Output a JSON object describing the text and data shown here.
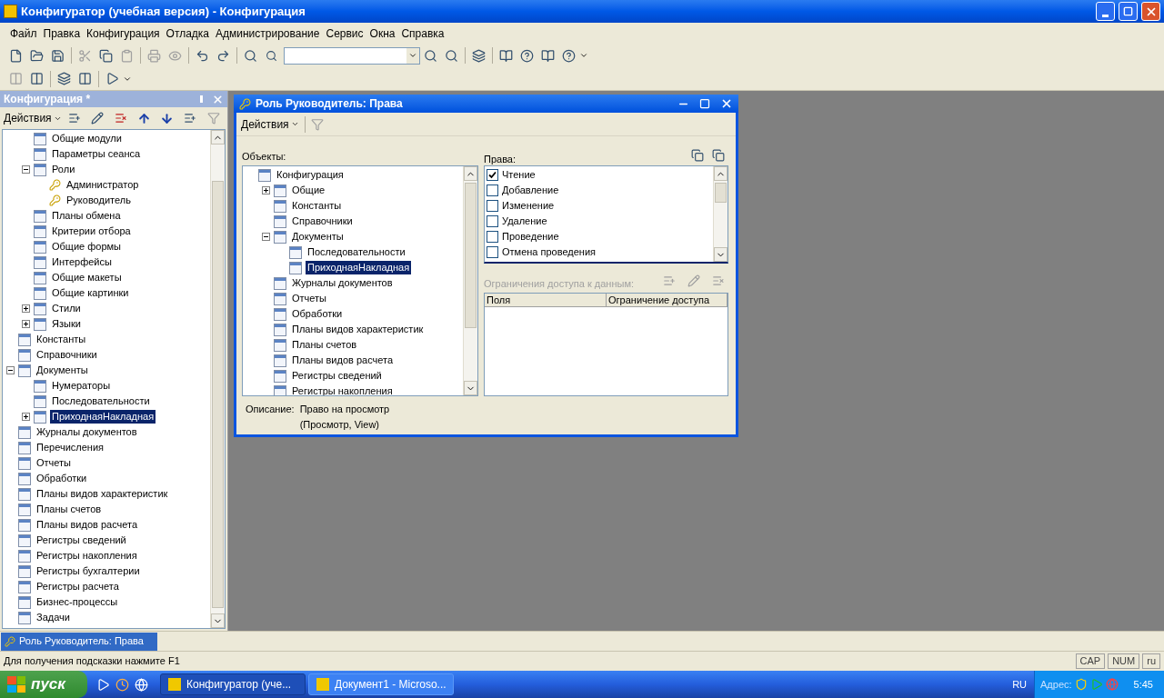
{
  "window": {
    "title": "Конфигуратор (учебная версия) - Конфигурация"
  },
  "menu": [
    "Файл",
    "Правка",
    "Конфигурация",
    "Отладка",
    "Администрирование",
    "Сервис",
    "Окна",
    "Справка"
  ],
  "config_panel": {
    "title": "Конфигурация *",
    "actions": "Действия",
    "tree": {
      "partial_group": [
        {
          "label": "Общие модули",
          "selected": false
        },
        {
          "label": "Параметры сеанса",
          "selected": false
        },
        {
          "label": "Роли",
          "selected": false,
          "expanded": true,
          "children": [
            {
              "label": "Администратор",
              "kind": "role",
              "selected": false
            },
            {
              "label": "Руководитель",
              "kind": "role",
              "selected": false
            }
          ]
        },
        {
          "label": "Планы обмена",
          "selected": false
        },
        {
          "label": "Критерии отбора",
          "selected": false
        },
        {
          "label": "Общие формы",
          "selected": false
        },
        {
          "label": "Интерфейсы",
          "selected": false
        },
        {
          "label": "Общие макеты",
          "selected": false
        },
        {
          "label": "Общие картинки",
          "selected": false
        },
        {
          "label": "Стили",
          "selected": false,
          "expanded": false
        },
        {
          "label": "Языки",
          "selected": false,
          "expanded": false
        }
      ],
      "items": [
        {
          "label": "Константы",
          "selected": false
        },
        {
          "label": "Справочники",
          "selected": false
        },
        {
          "label": "Документы",
          "selected": false,
          "expanded": true,
          "children": [
            {
              "label": "Нумераторы",
              "selected": false
            },
            {
              "label": "Последовательности",
              "selected": false
            },
            {
              "label": "ПриходнаяНакладная",
              "selected": true,
              "expanded": false
            }
          ]
        },
        {
          "label": "Журналы документов",
          "selected": false
        },
        {
          "label": "Перечисления",
          "selected": false
        },
        {
          "label": "Отчеты",
          "selected": false
        },
        {
          "label": "Обработки",
          "selected": false
        },
        {
          "label": "Планы видов характеристик",
          "selected": false
        },
        {
          "label": "Планы счетов",
          "selected": false
        },
        {
          "label": "Планы видов расчета",
          "selected": false
        },
        {
          "label": "Регистры сведений",
          "selected": false
        },
        {
          "label": "Регистры накопления",
          "selected": false
        },
        {
          "label": "Регистры бухгалтерии",
          "selected": false
        },
        {
          "label": "Регистры расчета",
          "selected": false
        },
        {
          "label": "Бизнес-процессы",
          "selected": false
        },
        {
          "label": "Задачи",
          "selected": false
        }
      ]
    }
  },
  "dialog": {
    "title": "Роль Руководитель: Права",
    "actions": "Действия",
    "objects_label": "Объекты:",
    "objects": [
      {
        "label": "Конфигурация",
        "selected": false,
        "children": [
          {
            "label": "Общие",
            "selected": false,
            "expanded": false
          },
          {
            "label": "Константы",
            "selected": false
          },
          {
            "label": "Справочники",
            "selected": false
          },
          {
            "label": "Документы",
            "selected": false,
            "expanded": true,
            "children": [
              {
                "label": "Последовательности",
                "selected": false
              },
              {
                "label": "ПриходнаяНакладная",
                "selected": true
              }
            ]
          },
          {
            "label": "Журналы документов",
            "selected": false
          },
          {
            "label": "Отчеты",
            "selected": false
          },
          {
            "label": "Обработки",
            "selected": false
          },
          {
            "label": "Планы видов характеристик",
            "selected": false
          },
          {
            "label": "Планы счетов",
            "selected": false
          },
          {
            "label": "Планы видов расчета",
            "selected": false
          },
          {
            "label": "Регистры сведений",
            "selected": false
          },
          {
            "label": "Регистры накопления",
            "selected": false
          }
        ]
      }
    ],
    "rights_label": "Права:",
    "rights": [
      {
        "label": "Чтение",
        "checked": true
      },
      {
        "label": "Добавление",
        "checked": false
      },
      {
        "label": "Изменение",
        "checked": false
      },
      {
        "label": "Удаление",
        "checked": false
      },
      {
        "label": "Проведение",
        "checked": false
      },
      {
        "label": "Отмена проведения",
        "checked": false
      }
    ],
    "restrictions": {
      "label": "Ограничения доступа к данным:",
      "disabled": true,
      "columns": [
        "Поля",
        "Ограничение доступа"
      ]
    },
    "description_label": "Описание:",
    "description_lines": [
      "Право на просмотр",
      "(Просмотр, View)"
    ]
  },
  "window_tabs": [
    {
      "label": "Роль Руководитель: Права",
      "selected": true
    }
  ],
  "status_bar": {
    "hint": "Для получения подсказки нажмите F1",
    "indicators": [
      "CAP",
      "NUM",
      "ru"
    ]
  },
  "taskbar": {
    "start": "пуск",
    "tasks": [
      {
        "label": "Конфигуратор (уче...",
        "selected": true
      },
      {
        "label": "Документ1 - Microso...",
        "selected": false
      }
    ],
    "language": "RU",
    "address": "Адрес:",
    "time": "5:45"
  }
}
